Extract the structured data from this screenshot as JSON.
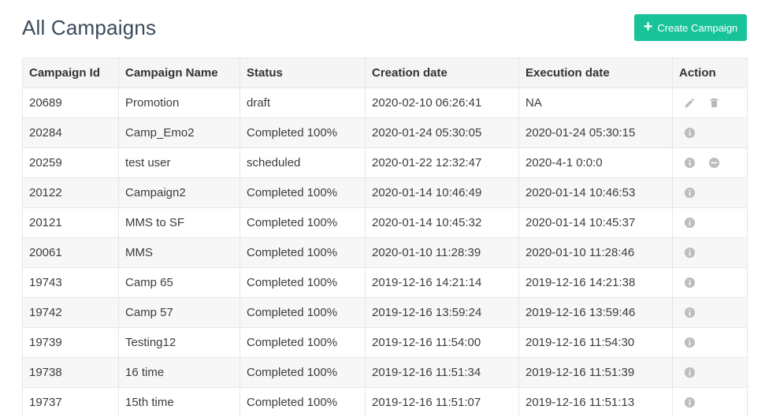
{
  "page": {
    "title": "All Campaigns",
    "create_button_label": "Create Campaign",
    "create_button_icon": "plus-icon",
    "accent_color": "#19c39a"
  },
  "table": {
    "columns": [
      "Campaign Id",
      "Campaign Name",
      "Status",
      "Creation date",
      "Execution date",
      "Action"
    ],
    "rows": [
      {
        "id": "20689",
        "name": "Promotion",
        "status": "draft",
        "created": "2020-02-10 06:26:41",
        "executed": "NA",
        "actions": [
          "edit-icon",
          "trash-icon"
        ]
      },
      {
        "id": "20284",
        "name": "Camp_Emo2",
        "status": "Completed 100%",
        "created": "2020-01-24 05:30:05",
        "executed": "2020-01-24 05:30:15",
        "actions": [
          "info-icon"
        ]
      },
      {
        "id": "20259",
        "name": "test user",
        "status": "scheduled",
        "created": "2020-01-22 12:32:47",
        "executed": "2020-4-1 0:0:0",
        "actions": [
          "info-icon",
          "minus-circle-icon"
        ]
      },
      {
        "id": "20122",
        "name": "Campaign2",
        "status": "Completed 100%",
        "created": "2020-01-14 10:46:49",
        "executed": "2020-01-14 10:46:53",
        "actions": [
          "info-icon"
        ]
      },
      {
        "id": "20121",
        "name": "MMS to SF",
        "status": "Completed 100%",
        "created": "2020-01-14 10:45:32",
        "executed": "2020-01-14 10:45:37",
        "actions": [
          "info-icon"
        ]
      },
      {
        "id": "20061",
        "name": "MMS",
        "status": "Completed 100%",
        "created": "2020-01-10 11:28:39",
        "executed": "2020-01-10 11:28:46",
        "actions": [
          "info-icon"
        ]
      },
      {
        "id": "19743",
        "name": "Camp 65",
        "status": "Completed 100%",
        "created": "2019-12-16 14:21:14",
        "executed": "2019-12-16 14:21:38",
        "actions": [
          "info-icon"
        ]
      },
      {
        "id": "19742",
        "name": "Camp 57",
        "status": "Completed 100%",
        "created": "2019-12-16 13:59:24",
        "executed": "2019-12-16 13:59:46",
        "actions": [
          "info-icon"
        ]
      },
      {
        "id": "19739",
        "name": "Testing12",
        "status": "Completed 100%",
        "created": "2019-12-16 11:54:00",
        "executed": "2019-12-16 11:54:30",
        "actions": [
          "info-icon"
        ]
      },
      {
        "id": "19738",
        "name": "16 time",
        "status": "Completed 100%",
        "created": "2019-12-16 11:51:34",
        "executed": "2019-12-16 11:51:39",
        "actions": [
          "info-icon"
        ]
      },
      {
        "id": "19737",
        "name": "15th time",
        "status": "Completed 100%",
        "created": "2019-12-16 11:51:07",
        "executed": "2019-12-16 11:51:13",
        "actions": [
          "info-icon"
        ]
      }
    ]
  }
}
